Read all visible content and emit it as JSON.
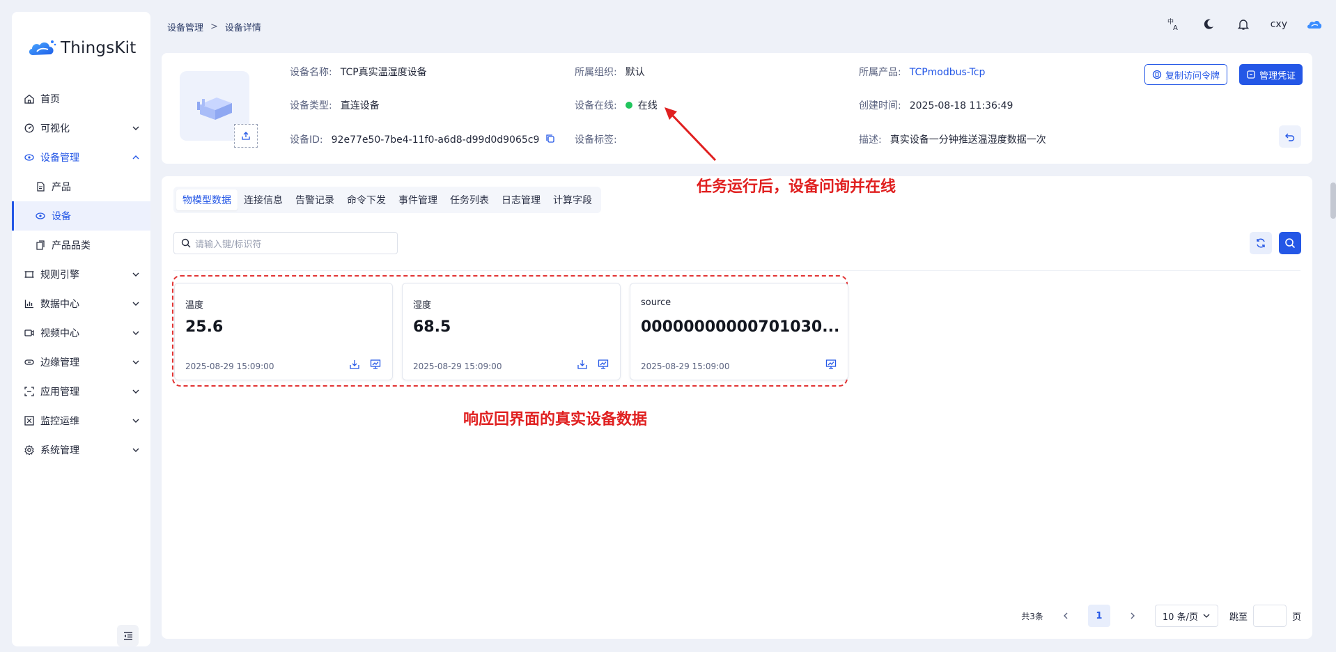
{
  "app": {
    "name": "ThingsKit"
  },
  "sidebar": {
    "items": [
      {
        "label": "首页",
        "icon": "home-icon",
        "expandable": false
      },
      {
        "label": "可视化",
        "icon": "dashboard-icon",
        "expandable": true
      },
      {
        "label": "设备管理",
        "icon": "device-icon",
        "expandable": true,
        "open": true
      },
      {
        "label": "产品",
        "icon": "file-icon",
        "sub": true
      },
      {
        "label": "设备",
        "icon": "device-icon",
        "sub": true,
        "active": true
      },
      {
        "label": "产品品类",
        "icon": "category-icon",
        "sub": true
      },
      {
        "label": "规则引擎",
        "icon": "rule-icon",
        "expandable": true
      },
      {
        "label": "数据中心",
        "icon": "chart-icon",
        "expandable": true
      },
      {
        "label": "视频中心",
        "icon": "video-icon",
        "expandable": true
      },
      {
        "label": "边缘管理",
        "icon": "edge-icon",
        "expandable": true
      },
      {
        "label": "应用管理",
        "icon": "app-icon",
        "expandable": true
      },
      {
        "label": "监控运维",
        "icon": "monitor-icon",
        "expandable": true
      },
      {
        "label": "系统管理",
        "icon": "gear-icon",
        "expandable": true
      }
    ]
  },
  "header": {
    "breadcrumb": [
      "设备管理",
      "设备详情"
    ],
    "user": "cxy"
  },
  "device": {
    "name_label": "设备名称:",
    "name": "TCP真实温湿度设备",
    "type_label": "设备类型:",
    "type": "直连设备",
    "id_label": "设备ID:",
    "id": "92e77e50-7be4-11f0-a6d8-d99d0d9065c9",
    "org_label": "所属组织:",
    "org": "默认",
    "online_label": "设备在线:",
    "online": "在线",
    "tag_label": "设备标签:",
    "product_label": "所属产品:",
    "product": "TCPmodbus-Tcp",
    "created_label": "创建时间:",
    "created": "2025-08-18 11:36:49",
    "desc_label": "描述:",
    "desc": "真实设备一分钟推送温湿度数据一次",
    "copy_token_button": "复制访问令牌",
    "manage_credential_button": "管理凭证"
  },
  "tabs": [
    "物模型数据",
    "连接信息",
    "告警记录",
    "命令下发",
    "事件管理",
    "任务列表",
    "日志管理",
    "计算字段"
  ],
  "search": {
    "placeholder": "请输入键/标识符"
  },
  "cards": [
    {
      "name": "温度",
      "value": "25.6",
      "time": "2025-08-29 15:09:00",
      "download": true
    },
    {
      "name": "湿度",
      "value": "68.5",
      "time": "2025-08-29 15:09:00",
      "download": true
    },
    {
      "name": "source",
      "value": "00000000000701030...",
      "time": "2025-08-29 15:09:00",
      "download": false
    }
  ],
  "pagination": {
    "total": "共3条",
    "page": "1",
    "size": "10 条/页",
    "jump_label": "跳至",
    "page_suffix": "页"
  },
  "annotations": {
    "online": "任务运行后，设备问询并在线",
    "data": "响应回界面的真实设备数据"
  },
  "colors": {
    "primary": "#2457e6",
    "annotation": "#e02020",
    "online": "#21c55d"
  }
}
